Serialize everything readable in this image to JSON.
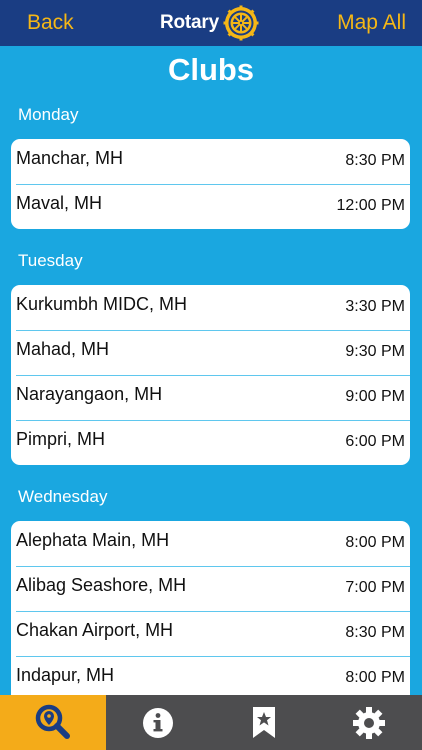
{
  "header": {
    "back_label": "Back",
    "logo_text": "Rotary",
    "map_all_label": "Map All"
  },
  "page_title": "Clubs",
  "sections": [
    {
      "day": "Monday",
      "clubs": [
        {
          "name": "Manchar, MH",
          "time": "8:30 PM"
        },
        {
          "name": "Maval, MH",
          "time": "12:00 PM"
        }
      ]
    },
    {
      "day": "Tuesday",
      "clubs": [
        {
          "name": "Kurkumbh MIDC, MH",
          "time": "3:30 PM"
        },
        {
          "name": "Mahad, MH",
          "time": "9:30 PM"
        },
        {
          "name": "Narayangaon, MH",
          "time": "9:00 PM"
        },
        {
          "name": "Pimpri, MH",
          "time": "6:00 PM"
        }
      ]
    },
    {
      "day": "Wednesday",
      "clubs": [
        {
          "name": "Alephata Main, MH",
          "time": "8:00 PM"
        },
        {
          "name": "Alibag Seashore, MH",
          "time": "7:00 PM"
        },
        {
          "name": "Chakan Airport, MH",
          "time": "8:30 PM"
        },
        {
          "name": "Indapur, MH",
          "time": "8:00 PM"
        }
      ]
    }
  ],
  "tabbar": {
    "tabs": [
      {
        "icon": "search-location-icon",
        "active": true
      },
      {
        "icon": "info-icon",
        "active": false
      },
      {
        "icon": "bookmark-star-icon",
        "active": false
      },
      {
        "icon": "gear-icon",
        "active": false
      }
    ]
  },
  "colors": {
    "background": "#1aa7e0",
    "navbar": "#1a3d83",
    "accent": "#f5b716",
    "tabbar": "#4d4d4f",
    "tab_active": "#f4ab19"
  }
}
